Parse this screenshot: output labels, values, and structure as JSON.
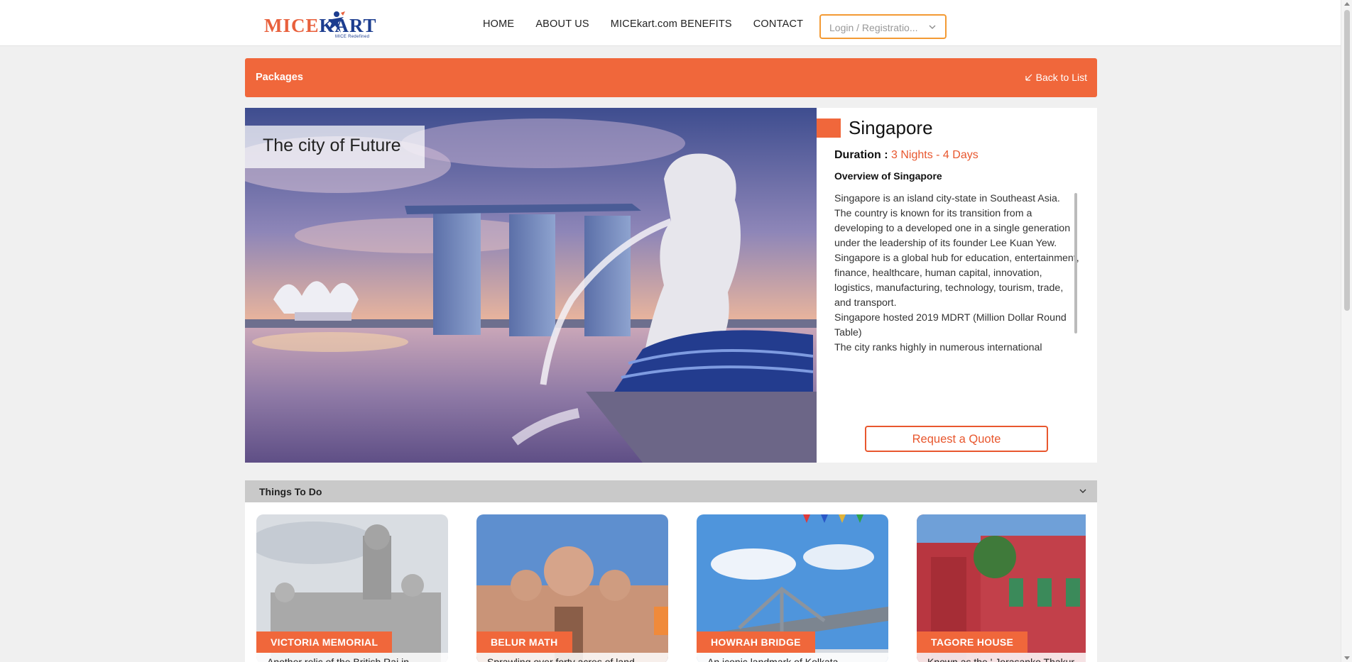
{
  "brand": {
    "name_left": "MICE",
    "name_right": "KART",
    "tagline": "MICE Redefined"
  },
  "nav": [
    {
      "label": "HOME"
    },
    {
      "label": "ABOUT US"
    },
    {
      "label": "MICEkart.com BENEFITS"
    },
    {
      "label": "CONTACT"
    }
  ],
  "login": {
    "placeholder": "Login / Registratio..."
  },
  "packages_bar": {
    "title": "Packages",
    "back_label": "Back to List"
  },
  "hero": {
    "tagline": "The city of Future"
  },
  "package": {
    "city": "Singapore",
    "duration_label": "Duration :",
    "duration_value": "3 Nights - 4 Days",
    "overview_heading": "Overview of Singapore",
    "overview_paragraphs": [
      "Singapore is an island city-state in Southeast Asia.",
      "The country is known for its transition from a developing to a developed one in a single generation under the leadership of its founder Lee Kuan Yew.",
      "Singapore is a global hub for education, entertainment, finance, healthcare, human capital, innovation, logistics, manufacturing, technology, tourism, trade, and transport.",
      "Singapore hosted 2019 MDRT (Million Dollar Round Table)",
      "The city ranks highly in numerous international"
    ],
    "quote_button": "Request a Quote"
  },
  "things_to_do": {
    "title": "Things To Do",
    "cards": [
      {
        "name": "VICTORIA MEMORIAL",
        "desc": "Another relic of the British Raj in"
      },
      {
        "name": "BELUR MATH",
        "desc": "Sprawling over forty acres of land"
      },
      {
        "name": "HOWRAH BRIDGE",
        "desc": "An iconic landmark of Kolkata"
      },
      {
        "name": "TAGORE HOUSE",
        "desc": "Known as the ' Jorasanko Thakur"
      }
    ]
  },
  "colors": {
    "accent": "#f0673b",
    "brand_blue": "#1c3d8f",
    "login_border": "#f39a34"
  }
}
